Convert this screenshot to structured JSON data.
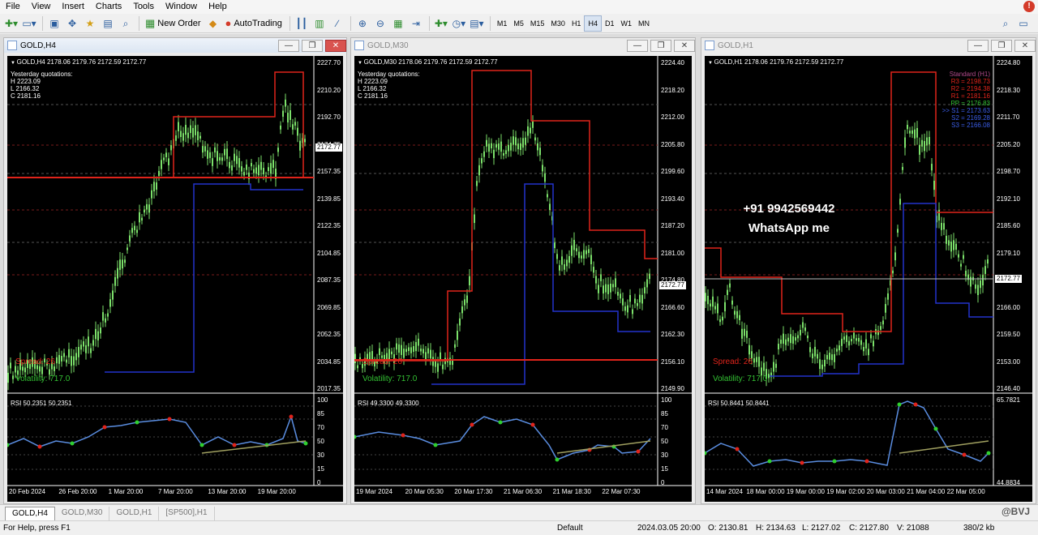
{
  "menu": [
    "File",
    "View",
    "Insert",
    "Charts",
    "Tools",
    "Window",
    "Help"
  ],
  "toolbar": {
    "new_order": "New Order",
    "autotrading": "AutoTrading",
    "timeframes": [
      "M1",
      "M5",
      "M15",
      "M30",
      "H1",
      "H4",
      "D1",
      "W1",
      "MN"
    ],
    "active_tf": "H4"
  },
  "windows": [
    {
      "title": "GOLD,H4",
      "header": "GOLD,H4  2178.06 2179.76 2172.59 2172.77",
      "yq": {
        "title": "Yesterday quotations:",
        "h": "H 2223.09",
        "l": "L 2166.32",
        "c": "C 2181.16"
      },
      "price_ticks": [
        "2227.70",
        "2210.20",
        "2192.70",
        "2174.75",
        "2157.35",
        "2139.85",
        "2122.35",
        "2104.85",
        "2087.35",
        "2069.85",
        "2052.35",
        "2034.85",
        "2017.35"
      ],
      "last_price": "2172.77",
      "spread": "Spread: 26",
      "volatility": "Volatility: 717.0",
      "rsi_label": "RSI 50.2351 50.2351",
      "rsi_ticks": [
        "100",
        "85",
        "70",
        "50",
        "30",
        "15",
        "0"
      ],
      "dates": [
        "20 Feb 2024",
        "26 Feb 20:00",
        "1 Mar 20:00",
        "7 Mar 20:00",
        "13 Mar 20:00",
        "19 Mar 20:00"
      ]
    },
    {
      "title": "GOLD,M30",
      "header": "GOLD,M30  2178.06 2179.76 2172.59 2172.77",
      "yq": {
        "title": "Yesterday quotations:",
        "h": "H 2223.09",
        "l": "L 2166.32",
        "c": "C 2181.16"
      },
      "price_ticks": [
        "2224.40",
        "2218.20",
        "2212.00",
        "2205.80",
        "2199.60",
        "2193.40",
        "2187.20",
        "2181.00",
        "2174.80",
        "2166.60",
        "2162.30",
        "2156.10",
        "2149.90"
      ],
      "last_price": "2172.77",
      "spread": "Spread: 26",
      "volatility": "Volatility: 717.0",
      "rsi_label": "RSI 49.3300 49.3300",
      "rsi_ticks": [
        "100",
        "85",
        "70",
        "50",
        "30",
        "15",
        "0"
      ],
      "dates": [
        "19 Mar 2024",
        "20 Mar 05:30",
        "20 Mar 17:30",
        "21 Mar 06:30",
        "21 Mar 18:30",
        "22 Mar 07:30"
      ]
    },
    {
      "title": "GOLD,H1",
      "header": "GOLD,H1  2178.06 2179.76 2172.59 2172.77",
      "pivots": [
        "Standard (H1)",
        "R3 = 2198.73",
        "R2 = 2194.38",
        "R1 = 2181.16",
        "PP = 2176.83",
        ">> S1 = 2173.63",
        "S2 = 2169.28",
        "S3 = 2166.08"
      ],
      "price_ticks": [
        "2224.80",
        "2218.30",
        "2211.70",
        "2205.20",
        "2198.70",
        "2192.10",
        "2185.60",
        "2179.10",
        "2172.77",
        "2166.00",
        "2159.50",
        "2153.00",
        "2146.40"
      ],
      "last_price": "2172.77",
      "spread": "Spread: 26",
      "volatility": "Volatility: 717.0",
      "rsi_label": "RSI 50.8441 50.8441",
      "rsi_ticks": [
        "65.7821",
        "44.8834"
      ],
      "dates": [
        "14 Mar 2024",
        "18 Mar 00:00",
        "19 Mar 00:00",
        "19 Mar 02:00",
        "20 Mar 03:00",
        "21 Mar 04:00",
        "22 Mar 05:00"
      ],
      "overlay": [
        "+91 9942569442",
        "WhatsApp me"
      ]
    }
  ],
  "tabs": [
    "GOLD,H4",
    "GOLD,M30",
    "GOLD,H1",
    "[SP500],H1"
  ],
  "watermark": "@BVJ",
  "status": {
    "help": "For Help, press F1",
    "profile": "Default",
    "time": "2024.03.05 20:00",
    "o": "O: 2130.81",
    "h": "H: 2134.63",
    "l": "L: 2127.02",
    "c": "C: 2127.80",
    "v": "V: 21088",
    "kb": "380/2 kb"
  },
  "colors": {
    "bg": "#000000",
    "candle": "#7be06a",
    "red_line": "#e0241b",
    "blue_line": "#2233cc",
    "rsi": "#5a8de0"
  }
}
